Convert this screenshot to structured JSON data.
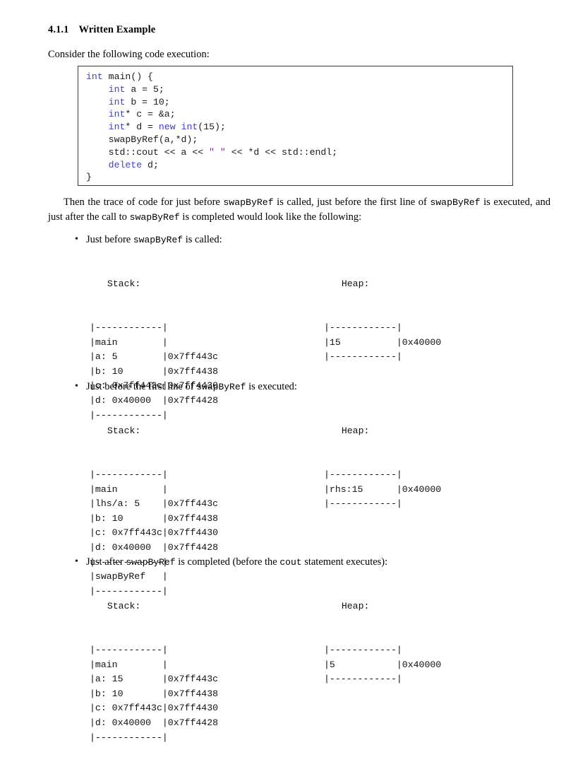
{
  "section": {
    "number": "4.1.1",
    "title": "Written Example"
  },
  "intro_paragraph": "Consider the following code execution:",
  "code_block": {
    "lines": [
      [
        {
          "t": "int",
          "c": "kw"
        },
        {
          "t": " main() {",
          "c": ""
        }
      ],
      [
        {
          "t": "    ",
          "c": ""
        },
        {
          "t": "int",
          "c": "kw"
        },
        {
          "t": " a = 5;",
          "c": ""
        }
      ],
      [
        {
          "t": "    ",
          "c": ""
        },
        {
          "t": "int",
          "c": "kw"
        },
        {
          "t": " b = 10;",
          "c": ""
        }
      ],
      [
        {
          "t": "    ",
          "c": ""
        },
        {
          "t": "int",
          "c": "kw"
        },
        {
          "t": "* c = &a;",
          "c": ""
        }
      ],
      [
        {
          "t": "    ",
          "c": ""
        },
        {
          "t": "int",
          "c": "kw"
        },
        {
          "t": "* d = ",
          "c": ""
        },
        {
          "t": "new int",
          "c": "kw"
        },
        {
          "t": "(15);",
          "c": ""
        }
      ],
      [
        {
          "t": "    swapByRef(a,*d);",
          "c": ""
        }
      ],
      [
        {
          "t": "    std::cout << a << ",
          "c": ""
        },
        {
          "t": "\" \"",
          "c": "str"
        },
        {
          "t": " << *d << std::endl;",
          "c": ""
        }
      ],
      [
        {
          "t": "    ",
          "c": ""
        },
        {
          "t": "delete",
          "c": "kw"
        },
        {
          "t": " d;",
          "c": ""
        }
      ],
      [
        {
          "t": "}",
          "c": ""
        }
      ]
    ]
  },
  "trace_paragraph": {
    "p1": "Then the trace of code for just before ",
    "fn1": "swapByRef",
    "p2": " is called, just before the first line of ",
    "fn2": "swapByRef",
    "p3": " is executed, and just after the call to ",
    "fn3": "swapByRef",
    "p4": " is completed would look like the following:"
  },
  "bullets": [
    {
      "label_pre": "Just before ",
      "label_fn": "swapByRef",
      "label_mid": " is called:",
      "label_fn2": "",
      "label_post": "",
      "stack_header": "  Stack:",
      "heap_header": "  Heap:",
      "stack_rows": [
        "|------------|",
        "|main        |",
        "|a: 5        |0x7ff443c",
        "|b: 10       |0x7ff4438",
        "|c: 0x7ff443c|0x7ff4430",
        "|d: 0x40000  |0x7ff4428",
        "|------------|"
      ],
      "heap_rows": [
        "|------------|",
        "|15          |0x40000",
        "|------------|"
      ]
    },
    {
      "label_pre": "Just before the first line of ",
      "label_fn": "swapByRef",
      "label_mid": " is executed:",
      "label_fn2": "",
      "label_post": "",
      "stack_header": "  Stack:",
      "heap_header": "  Heap:",
      "stack_rows": [
        "|------------|",
        "|main        |",
        "|lhs/a: 5    |0x7ff443c",
        "|b: 10       |0x7ff4438",
        "|c: 0x7ff443c|0x7ff4430",
        "|d: 0x40000  |0x7ff4428",
        "|------------|",
        "|swapByRef   |",
        "|------------|"
      ],
      "heap_rows": [
        "|------------|",
        "|rhs:15      |0x40000",
        "|------------|"
      ]
    },
    {
      "label_pre": "Just after ",
      "label_fn": "swapByRef",
      "label_mid": " is completed (before the ",
      "label_fn2": "cout",
      "label_post": " statement executes):",
      "stack_header": "  Stack:",
      "heap_header": "  Heap:",
      "stack_rows": [
        "|------------|",
        "|main        |",
        "|a: 15       |0x7ff443c",
        "|b: 10       |0x7ff4438",
        "|c: 0x7ff443c|0x7ff4430",
        "|d: 0x40000  |0x7ff4428",
        "|------------|"
      ],
      "heap_rows": [
        "|------------|",
        "|5           |0x40000",
        "|------------|"
      ]
    }
  ],
  "colors": {
    "keyword": "#4242cc",
    "string": "#a020a0",
    "text": "#000000",
    "code_border": "#3a3a3a",
    "background": "#ffffff"
  }
}
